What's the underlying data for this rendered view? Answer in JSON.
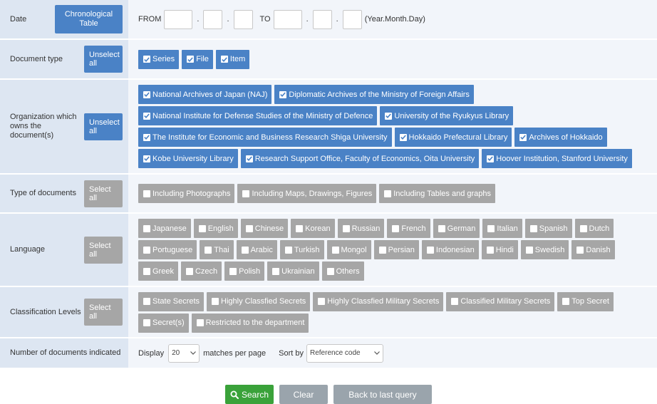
{
  "date": {
    "label": "Date",
    "chrono_button": "Chronological Table",
    "from_label": "FROM",
    "to_label": "TO",
    "sep": ".",
    "format_hint": "(Year.Month.Day)"
  },
  "document_type": {
    "label": "Document type",
    "button": "Unselect all",
    "options": [
      "Series",
      "File",
      "Item"
    ]
  },
  "organization": {
    "label": "Organization which owns the document(s)",
    "button": "Unselect all",
    "options": [
      "National Archives of Japan (NAJ)",
      "Diplomatic Archives of the Ministry of Foreign Affairs",
      "National Institute for Defense Studies of the Ministry of Defence",
      "University of the Ryukyus Library",
      "The Institute for Economic and Business Research Shiga University",
      "Hokkaido Prefectural Library",
      "Archives of Hokkaido",
      "Kobe University Library",
      "Research Support Office, Faculty of Economics, Oita University",
      "Hoover Institution, Stanford University"
    ]
  },
  "type_of_documents": {
    "label": "Type of documents",
    "button": "Select all",
    "options": [
      "Including Photographs",
      "Including Maps, Drawings, Figures",
      "Including Tables and graphs"
    ]
  },
  "language": {
    "label": "Language",
    "button": "Select all",
    "options": [
      "Japanese",
      "English",
      "Chinese",
      "Korean",
      "Russian",
      "French",
      "German",
      "Italian",
      "Spanish",
      "Dutch",
      "Portuguese",
      "Thai",
      "Arabic",
      "Turkish",
      "Mongol",
      "Persian",
      "Indonesian",
      "Hindi",
      "Swedish",
      "Danish",
      "Greek",
      "Czech",
      "Polish",
      "Ukrainian",
      "Others"
    ]
  },
  "classification": {
    "label": "Classification Levels",
    "button": "Select all",
    "options": [
      "State Secrets",
      "Highly Classfied Secrets",
      "Highly Classfied Military Secrets",
      "Classified Military Secrets",
      "Top Secret",
      "Secret(s)",
      "Restricted to the department"
    ]
  },
  "number_indicated": {
    "label": "Number of documents indicated",
    "display_label": "Display",
    "display_value": "20",
    "per_page_label": "matches per page",
    "sort_label": "Sort by",
    "sort_value": "Reference code"
  },
  "actions": {
    "search": "Search",
    "clear": "Clear",
    "back": "Back to last query"
  },
  "colors": {
    "selected_chip": "#4a82c6",
    "unselected_chip": "#a6a6a6",
    "search_button": "#3aa23a",
    "label_bg": "#dde6f2",
    "content_bg": "#f2f5fa"
  }
}
